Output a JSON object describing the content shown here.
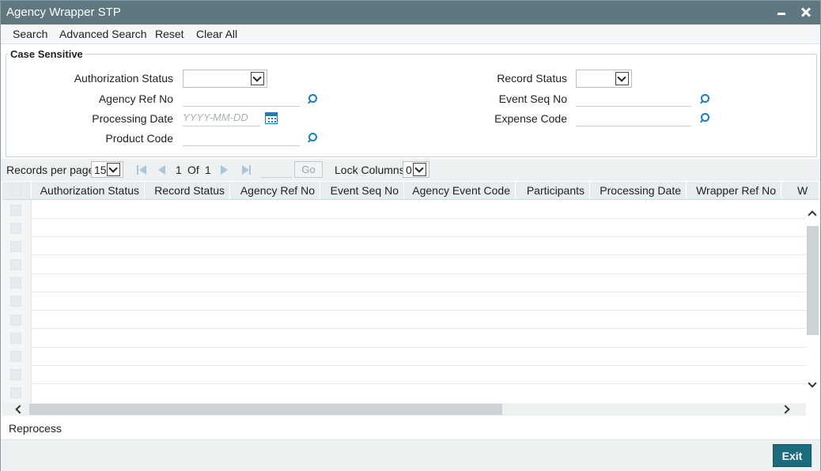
{
  "window": {
    "title": "Agency Wrapper STP"
  },
  "toolbar": {
    "search": "Search",
    "advanced_search": "Advanced Search",
    "reset": "Reset",
    "clear_all": "Clear All"
  },
  "criteria": {
    "legend": "Case Sensitive",
    "authorization_status_label": "Authorization Status",
    "authorization_status_value": "",
    "record_status_label": "Record Status",
    "record_status_value": "",
    "agency_ref_no_label": "Agency Ref No",
    "agency_ref_no_value": "",
    "event_seq_no_label": "Event Seq No",
    "event_seq_no_value": "",
    "processing_date_label": "Processing Date",
    "processing_date_placeholder": "YYYY-MM-DD",
    "expense_code_label": "Expense Code",
    "expense_code_value": "",
    "product_code_label": "Product Code",
    "product_code_value": ""
  },
  "pager": {
    "records_per_page_label": "Records per page",
    "records_per_page_value": "15",
    "current_page": "1",
    "of_label": "Of",
    "total_pages": "1",
    "go_label": "Go",
    "lock_columns_label": "Lock Columns",
    "lock_columns_value": "0"
  },
  "grid": {
    "columns": [
      "Authorization Status",
      "Record Status",
      "Agency Ref No",
      "Event Seq No",
      "Agency Event Code",
      "Participants",
      "Processing Date",
      "Wrapper Ref No",
      "W"
    ]
  },
  "actions": {
    "reprocess": "Reprocess",
    "exit": "Exit"
  }
}
